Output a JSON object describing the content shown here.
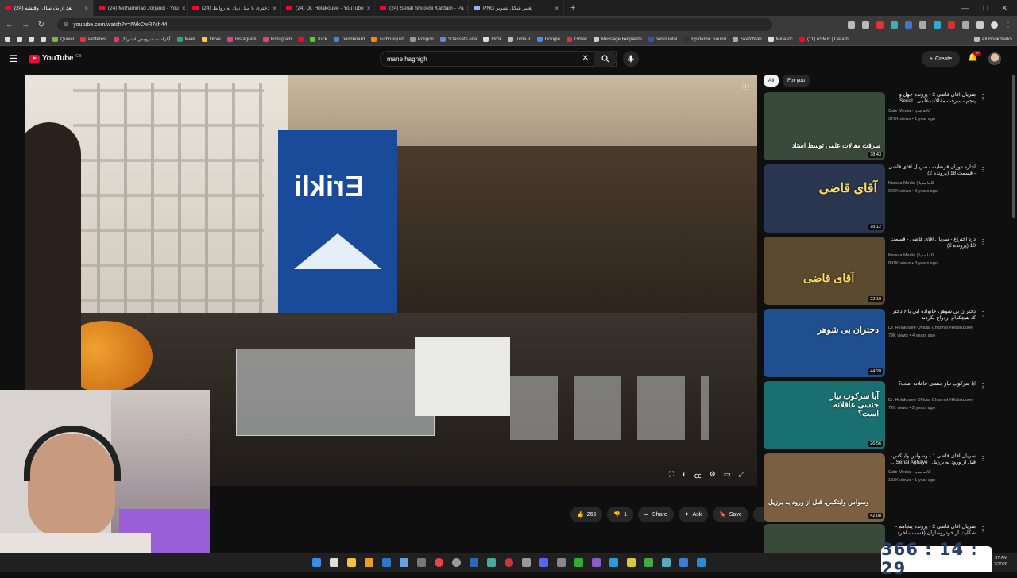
{
  "browser": {
    "tabs": [
      {
        "label": "(24) بعد از یک سال، وقتشه",
        "active": true
      },
      {
        "label": "(24) Mohammad Jorjandi - You"
      },
      {
        "label": "(24) دختری با میل زیاد به روابط"
      },
      {
        "label": "(24) Dr. Holakouee - YouTube"
      },
      {
        "label": "(24) Serial Shookhi Kardam - Pa"
      },
      {
        "label": "PNG تغییر شکل تصویر"
      }
    ],
    "url": "youtube.com/watch?v=IWkCwR7ch44",
    "bookmarks": [
      "Quixel",
      "Pinterest",
      "آپارات - سرویس اشتراک",
      "Meet",
      "Drive",
      "Instagram",
      "Instagram",
      "Kick",
      "Dashboard",
      "TurboSquid",
      "Poligon",
      "3Dassets.one",
      "Grok",
      "Time.ir",
      "Google",
      "Gmail",
      "Message Requests",
      "VirusTotal",
      "Epidemic Sound",
      "Sketchfab",
      "MinePic",
      "(11) ASMR | Cerami...",
      "All Bookmarks"
    ]
  },
  "youtube": {
    "logo_text": "YouTube",
    "country_code": "GB",
    "search_value": "mane haghigh",
    "create_label": "Create",
    "notif_count": "9+",
    "chips": [
      "All",
      "For you"
    ],
    "actions": {
      "like_count": "266",
      "dislike_count": "1",
      "share_label": "Share",
      "ask_label": "Ask",
      "save_label": "Save"
    },
    "video_sign_text": "Erikli",
    "recommendations": [
      {
        "title": "سریال آقای قاضی 2 - پرونده چهل و پنجم - سرقت مقالات علمی | Serial ...",
        "channel": "Cafe Media - کافه مدیا",
        "meta": "327K views • 1 year ago",
        "duration": "38:43",
        "thumb_text": "سرقت مقالات علمی توسط استاد",
        "thumb_color": "#3a4a3a"
      },
      {
        "title": "اجاره دوران قرنطینه - سریال آقای قاضی - قسمت 18 (پرونده 2)",
        "channel": "Kamaa Media | کاما مدیا",
        "meta": "620K views • 3 years ago",
        "duration": "18:12",
        "thumb_text": "آقای قاضی",
        "thumb_color": "#2a3550"
      },
      {
        "title": "دزد اختراع - سریال آقای قاضی - قسمت 10 (پرونده 2)",
        "channel": "Kamaa Media | کاما مدیا",
        "meta": "891K views • 3 years ago",
        "duration": "22:19",
        "thumb_text": "آقای قاضی",
        "thumb_color": "#5a4a30"
      },
      {
        "title": "دختران بی شوهر، خانواده ایی با ۶ دختر که هیچکدام ازدواج نکردند",
        "channel": "Dr. Holakouee Official Channel #Holakouee",
        "meta": "79K views • 4 years ago",
        "duration": "44:28",
        "thumb_text": "دختران بی شوهر",
        "thumb_color": "#1f4f8f"
      },
      {
        "title": "آیا سرکوب نیاز جنسی عاقلانه است؟",
        "channel": "Dr. Holakouee Official Channel #Holakouee",
        "meta": "72K views • 2 years ago",
        "duration": "26:56",
        "thumb_text": "آیا سرکوب نیاز جنسی عاقلانه است؟",
        "thumb_color": "#1a7070"
      },
      {
        "title": "سریال آقای قاضی 1 - وسواس وابتکس، قبل از ورود به برزیل | Serial Aghaye ...",
        "channel": "Cafe Media - کافه مدیا",
        "meta": "133K views • 1 year ago",
        "duration": "42:08",
        "thumb_text": "وسواس وابتکس، قبل از ورود به برزیل",
        "thumb_color": "#7a6040"
      },
      {
        "title": "سریال آقای قاضی 2 - پرونده پنجاهم - شکایت از خودروسازان (قسمت آخر)",
        "channel": "",
        "meta": "",
        "duration": "",
        "thumb_text": "",
        "thumb_color": "#3a4a3a"
      }
    ]
  },
  "overlay_timer": "366 : 14 : 29",
  "system_clock": {
    "time": "37 AM",
    "date": "2/2026"
  }
}
